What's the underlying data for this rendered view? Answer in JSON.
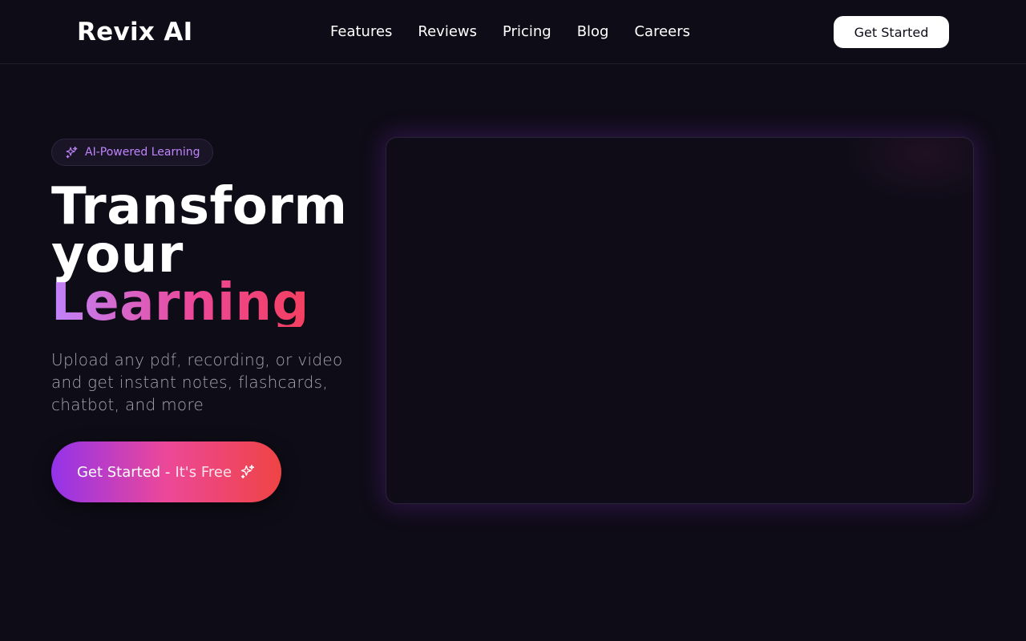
{
  "header": {
    "logo": "Revix AI",
    "nav": [
      "Features",
      "Reviews",
      "Pricing",
      "Blog",
      "Careers"
    ],
    "cta_label": "Get Started"
  },
  "hero": {
    "badge_icon": "sparkles-icon",
    "badge_label": "AI-Powered Learning",
    "headline_line1": "Transform",
    "headline_line2": "your",
    "headline_highlight": "Learning",
    "subtext": "Upload any pdf, recording, or video and get instant notes, flashcards, chatbot, and more",
    "cta_main": "Get Started -",
    "cta_sub": "It's Free",
    "cta_icon": "sparkles-icon"
  },
  "colors": {
    "background": "#0e0c16",
    "accent_purple": "#c084fc",
    "accent_pink": "#ec4899",
    "accent_red": "#ef4444"
  }
}
